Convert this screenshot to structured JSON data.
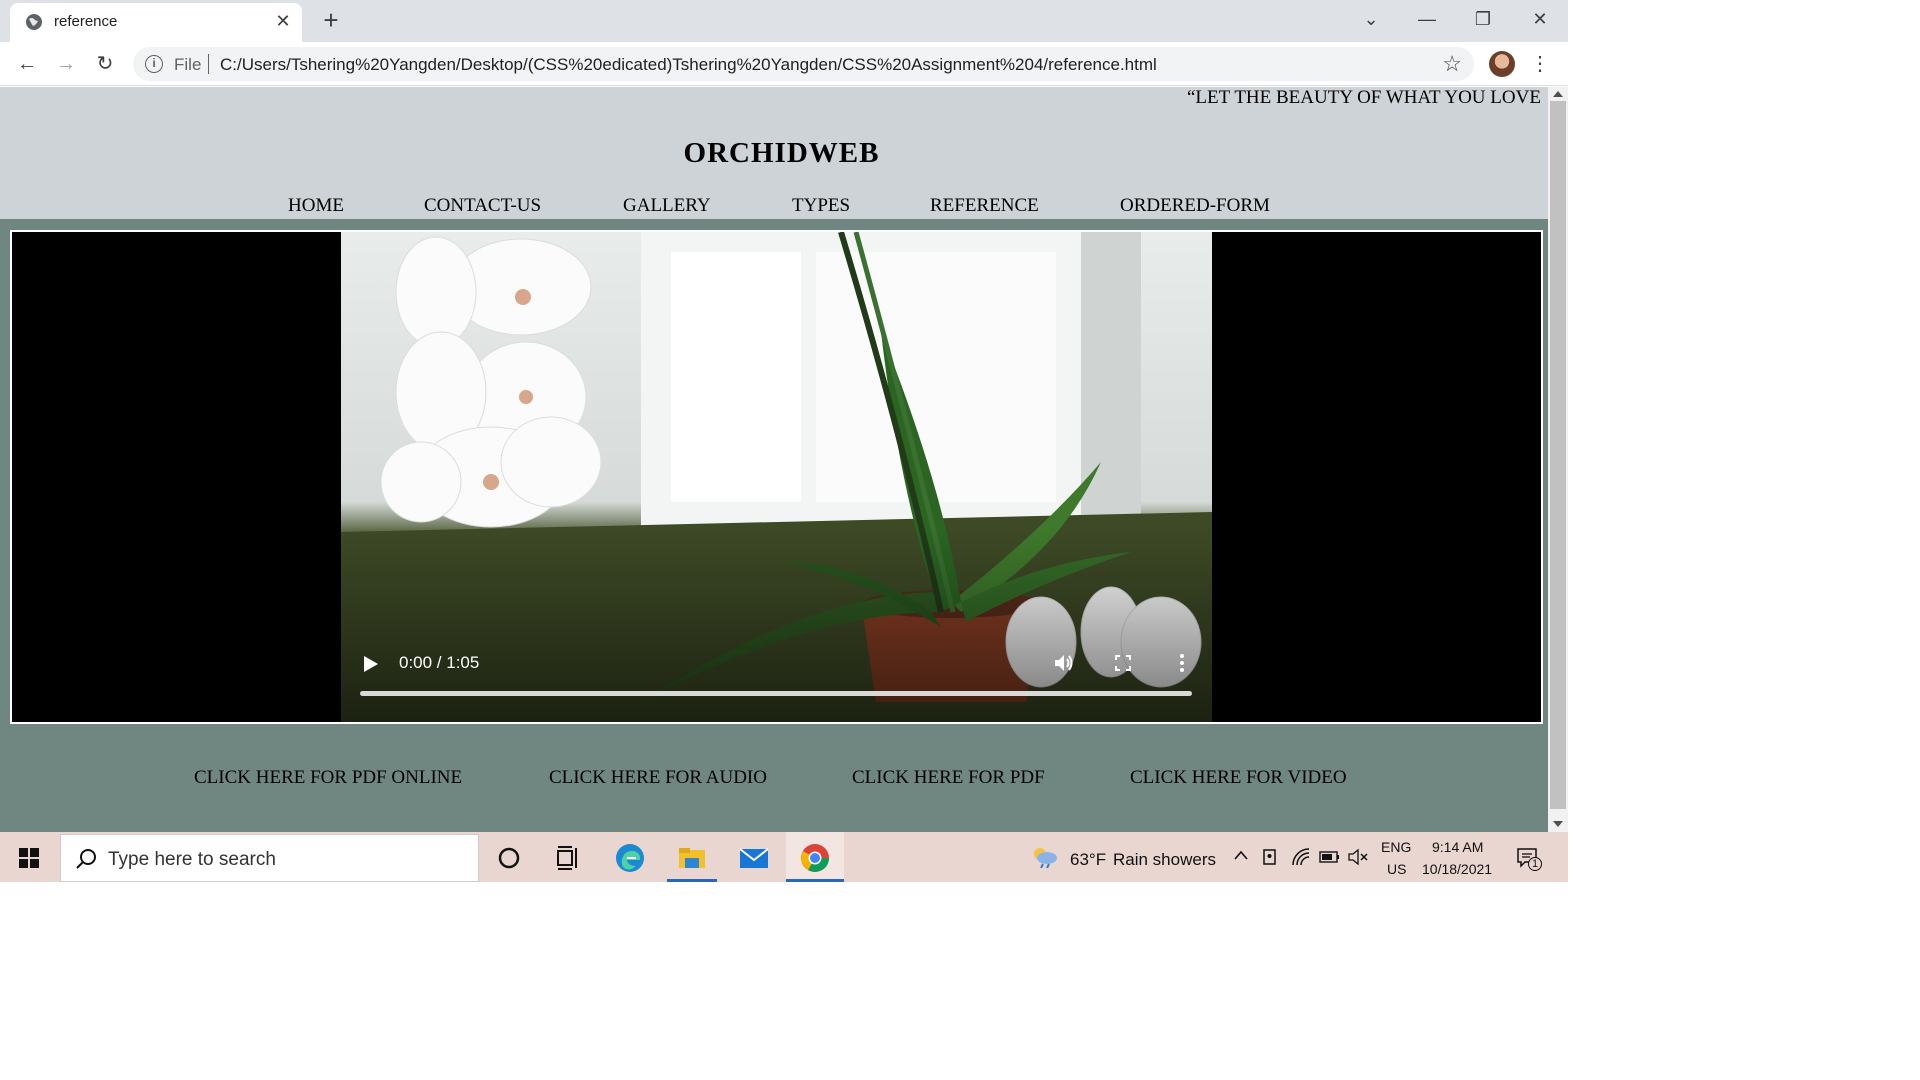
{
  "browser": {
    "tab_title": "reference",
    "tab_close": "✕",
    "new_tab": "+",
    "address_scheme": "File",
    "address_url": "C:/Users/Tshering%20Yangden/Desktop/(CSS%20edicated)Tshering%20Yangden/CSS%20Assignment%204/reference.html",
    "back": "←",
    "forward": "→",
    "reload": "↻",
    "star": "☆",
    "menu": "⋮",
    "win_minimize": "—",
    "win_restore": "❐",
    "win_close": "✕",
    "tab_search": "⌄"
  },
  "page": {
    "marquee": "“LET THE BEAUTY OF WHAT YOU LOVE",
    "title": "ORCHIDWEB",
    "nav": [
      "HOME",
      "CONTACT-US",
      "GALLERY",
      "TYPES",
      "REFERENCE",
      "ORDERED-FORM"
    ],
    "video": {
      "time": "0:00 / 1:05",
      "progress": 0.0
    },
    "footer_links": [
      "CLICK HERE FOR PDF ONLINE",
      "CLICK HERE FOR AUDIO",
      "CLICK HERE FOR PDF",
      "CLICK HERE FOR VIDEO"
    ],
    "colors": {
      "header_bg": "#cdd3d6",
      "body_bg": "#708680"
    }
  },
  "taskbar": {
    "search_placeholder": "Type here to search",
    "weather_temp": "63°F",
    "weather_text": "Rain showers",
    "lang_top": "ENG",
    "lang_bottom": "US",
    "time": "9:14 AM",
    "date": "10/18/2021",
    "notification_count": "1",
    "apps": [
      "cortana-icon",
      "task-view-icon",
      "edge-icon",
      "file-explorer-icon",
      "mail-icon",
      "chrome-icon"
    ]
  }
}
